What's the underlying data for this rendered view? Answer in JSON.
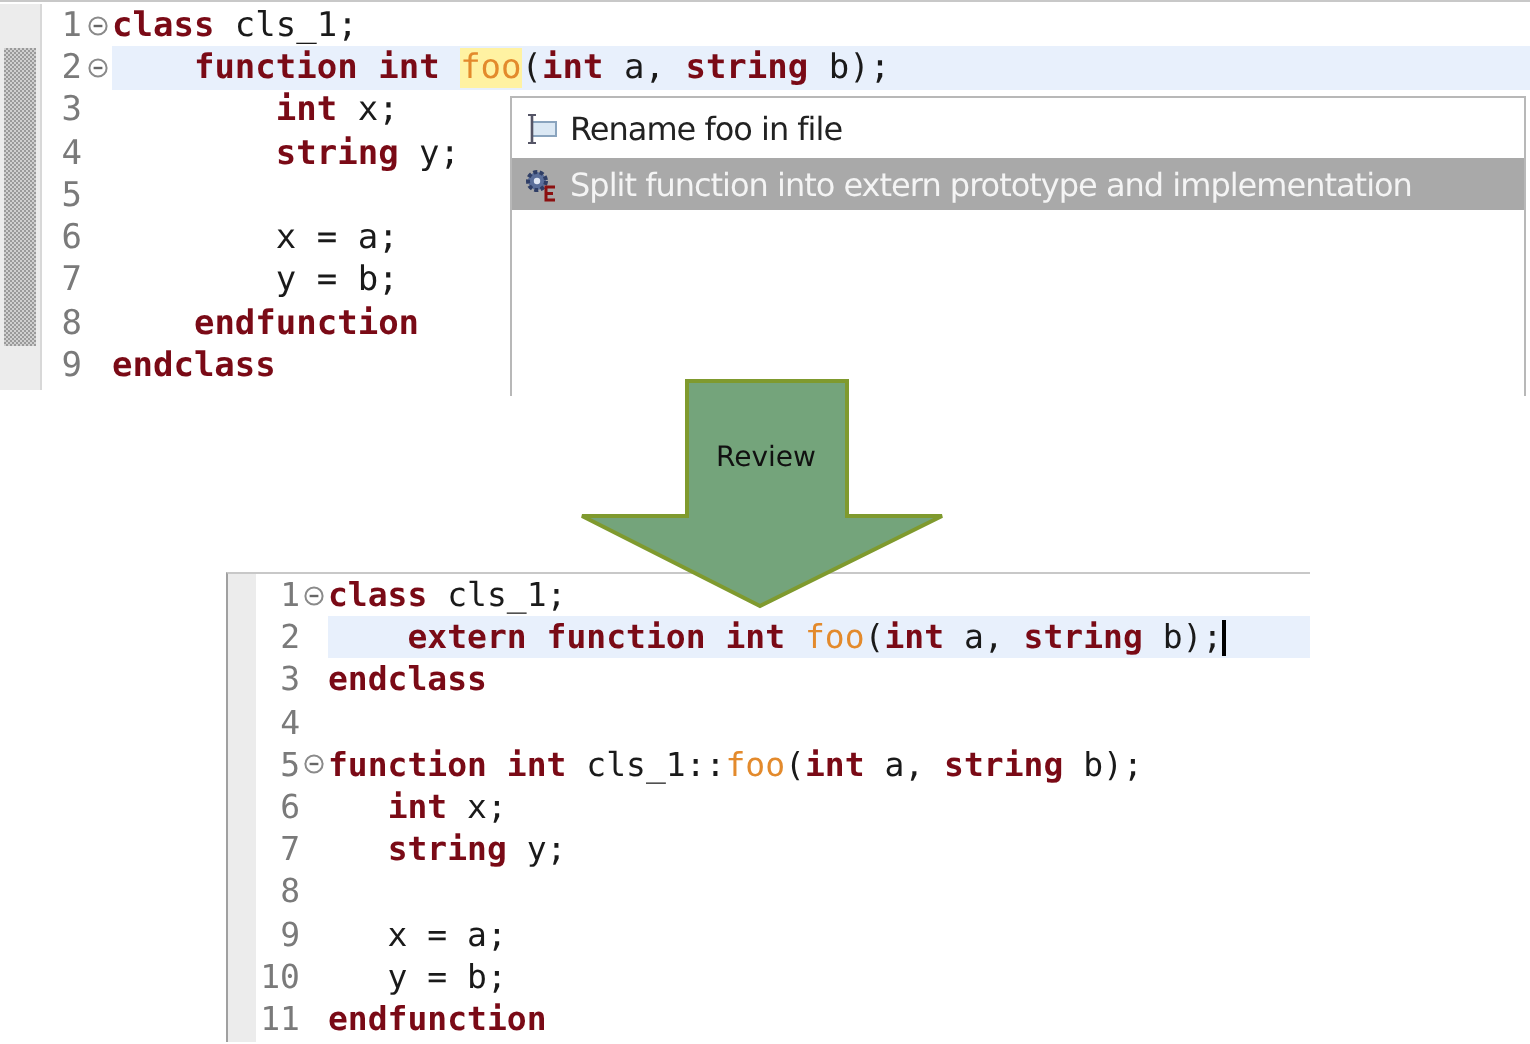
{
  "editors": [
    {
      "mark_occurrences": true,
      "lines": [
        {
          "number": "1",
          "fold": true,
          "text": "**class** cls_1;"
        },
        {
          "number": "2",
          "fold": true,
          "current": true,
          "text": "    **function** **int** *foo*(**int** a, **string** b);"
        },
        {
          "number": "3",
          "text": "        **int** x;"
        },
        {
          "number": "4",
          "text": "        **string** y;"
        },
        {
          "number": "5"
        },
        {
          "number": "6",
          "text": "        x = a;"
        },
        {
          "number": "7",
          "text": "        y = b;"
        },
        {
          "number": "8",
          "text": "    **endfunction**"
        },
        {
          "number": "9",
          "text": "**endclass**"
        }
      ]
    },
    {
      "caret": true,
      "lines": [
        {
          "number": "1",
          "fold": true,
          "text": "**class** cls_1;"
        },
        {
          "number": "2",
          "current": true,
          "text": "    **extern** **function** **int** *foo*(**int** a, **string** b);"
        },
        {
          "number": "3",
          "text": "**endclass**"
        },
        {
          "number": "4"
        },
        {
          "number": "5",
          "fold": true,
          "text": "**function** **int** cls_1::*foo*(**int** a, **string** b);"
        },
        {
          "number": "6",
          "text": "   **int** x;"
        },
        {
          "number": "7",
          "text": "   **string** y;"
        },
        {
          "number": "8"
        },
        {
          "number": "9",
          "text": "   x = a;"
        },
        {
          "number": "10",
          "text": "   y = b;"
        },
        {
          "number": "11",
          "text": "**endfunction**"
        }
      ]
    }
  ],
  "quick_assist": {
    "items": [
      {
        "label": "Rename foo in file",
        "selected": false
      },
      {
        "label": "Split function into extern prototype and implementation",
        "selected": true
      }
    ]
  },
  "arrow": {
    "label": "Review"
  }
}
